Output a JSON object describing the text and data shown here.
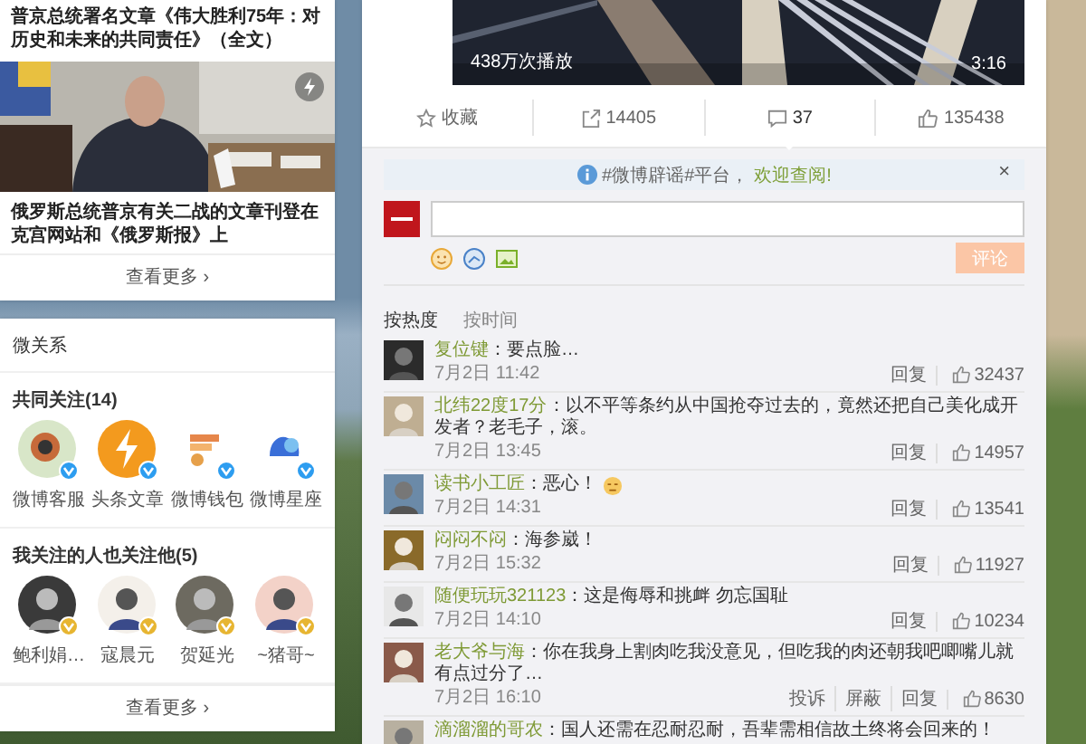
{
  "news_card": {
    "headline": "普京总统署名文章《伟大胜利75年：对历史和未来的共同责任》（全文）",
    "caption": "俄罗斯总统普京有关二战的文章刊登在克宫网站和《俄罗斯报》上",
    "more": "查看更多",
    "more_arrow": "›"
  },
  "relations_card": {
    "title": "微关系",
    "groups": [
      {
        "title": "共同关注(14)",
        "kind": "official",
        "accounts": [
          {
            "name": "微博客服"
          },
          {
            "name": "头条文章"
          },
          {
            "name": "微博钱包"
          },
          {
            "name": "微博星座"
          }
        ]
      },
      {
        "title": "我关注的人也关注他(5)",
        "kind": "personal",
        "accounts": [
          {
            "name": "鲍利娟…"
          },
          {
            "name": "寇晨元"
          },
          {
            "name": "贺延光"
          },
          {
            "name": "~猪哥~"
          }
        ]
      }
    ],
    "more": "查看更多",
    "more_arrow": "›"
  },
  "video": {
    "plays": "438万次播放",
    "duration": "3:16"
  },
  "actions": [
    {
      "kind": "favorite",
      "label": "收藏",
      "selected": false
    },
    {
      "kind": "repost",
      "label": "14405",
      "selected": false
    },
    {
      "kind": "comment",
      "label": "37",
      "selected": true
    },
    {
      "kind": "like",
      "label": "135438",
      "selected": false
    }
  ],
  "notice": {
    "text": "#微博辟谣#平台，",
    "link": "欢迎查阅!",
    "close": "×"
  },
  "composer": {
    "submit": "评论",
    "disabled": true
  },
  "sort_tabs": [
    {
      "label": "按热度",
      "selected": true
    },
    {
      "label": "按时间",
      "selected": false
    }
  ],
  "comments": [
    {
      "user": "复位键",
      "text": "：要点脸…",
      "sticker": false,
      "time": "7月2日 11:42",
      "actions": [
        "回复"
      ],
      "likes": "32437"
    },
    {
      "user": "北纬22度17分",
      "text": "：以不平等条约从中国抢夺过去的，竟然还把自己美化成开发者？老毛子，滚。",
      "sticker": false,
      "time": "7月2日 13:45",
      "actions": [
        "回复"
      ],
      "likes": "14957"
    },
    {
      "user": "读书小工匠",
      "text": "：恶心！",
      "sticker": true,
      "time": "7月2日 14:31",
      "actions": [
        "回复"
      ],
      "likes": "13541"
    },
    {
      "user": "闷闷不闷",
      "text": "：海参崴！",
      "sticker": false,
      "time": "7月2日 15:32",
      "actions": [
        "回复"
      ],
      "likes": "11927"
    },
    {
      "user": "随便玩玩321123",
      "text": "：这是侮辱和挑衅 勿忘国耻",
      "sticker": false,
      "time": "7月2日 14:10",
      "actions": [
        "回复"
      ],
      "likes": "10234"
    },
    {
      "user": "老大爷与海",
      "text": "：你在我身上割肉吃我没意见，但吃我的肉还朝我吧唧嘴儿就有点过分了…",
      "sticker": false,
      "time": "7月2日 16:10",
      "actions": [
        "投诉",
        "屏蔽",
        "回复"
      ],
      "likes": "8630"
    },
    {
      "user": "滴溜溜的哥农",
      "text": "：国人还需在忍耐忍耐，吾辈需相信故土终将会回来的！",
      "sticker": false
    }
  ]
}
